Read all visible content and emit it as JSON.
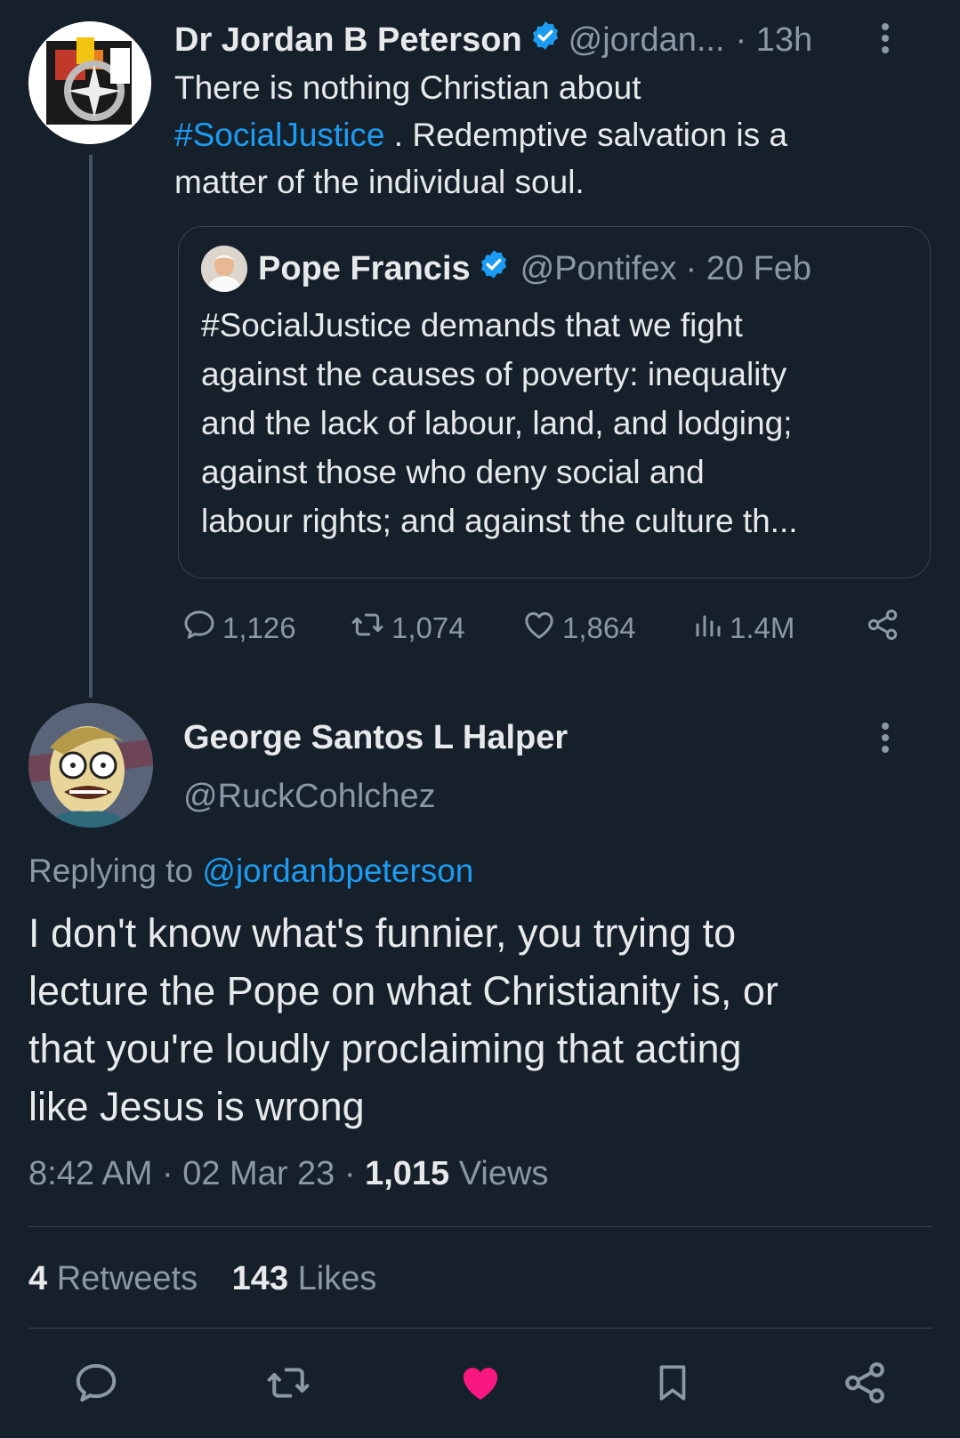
{
  "original_tweet": {
    "author_name": "Dr Jordan B Peterson",
    "handle": "@jordan...",
    "time": "· 13h",
    "text_line1": "There is nothing Christian about",
    "hashtag": "#SocialJustice",
    "text_after_hashtag": " . Redemptive salvation is a",
    "text_line3": "matter of the individual soul.",
    "quoted": {
      "author_name": "Pope Francis",
      "handle": "@Pontifex",
      "time": "· 20 Feb",
      "lines": [
        "#SocialJustice demands that we fight",
        "against the causes of poverty: inequality",
        "and the lack of labour, land, and lodging;",
        "against those who deny social and",
        "labour rights; and against the culture th..."
      ]
    },
    "stats": {
      "replies": "1,126",
      "retweets": "1,074",
      "likes": "1,864",
      "views": "1.4M"
    }
  },
  "reply_tweet": {
    "author_name": "George Santos L Halper",
    "handle": "@RuckCohlchez",
    "replying_to_label": "Replying to",
    "replying_to_handle": "@jordanbpeterson",
    "lines": [
      "I don't know what's funnier, you trying to",
      "lecture the Pope on what Christianity is, or",
      "that you're loudly proclaiming that acting",
      "like Jesus is wrong"
    ],
    "time": "8:42 AM",
    "sep1": "·",
    "date": "02 Mar 23",
    "sep2": "·",
    "views_count": "1,015",
    "views_label": "Views",
    "retweets_count": "4",
    "retweets_label": "Retweets",
    "likes_count": "143",
    "likes_label": "Likes"
  },
  "colors": {
    "background": "#15202b",
    "link": "#1d9bf0",
    "like_active": "#f91880",
    "muted": "#8b98a5"
  },
  "icons": [
    "more-icon",
    "verified-icon",
    "reply-icon",
    "retweet-icon",
    "like-icon",
    "views-icon",
    "share-icon",
    "bookmark-icon"
  ]
}
